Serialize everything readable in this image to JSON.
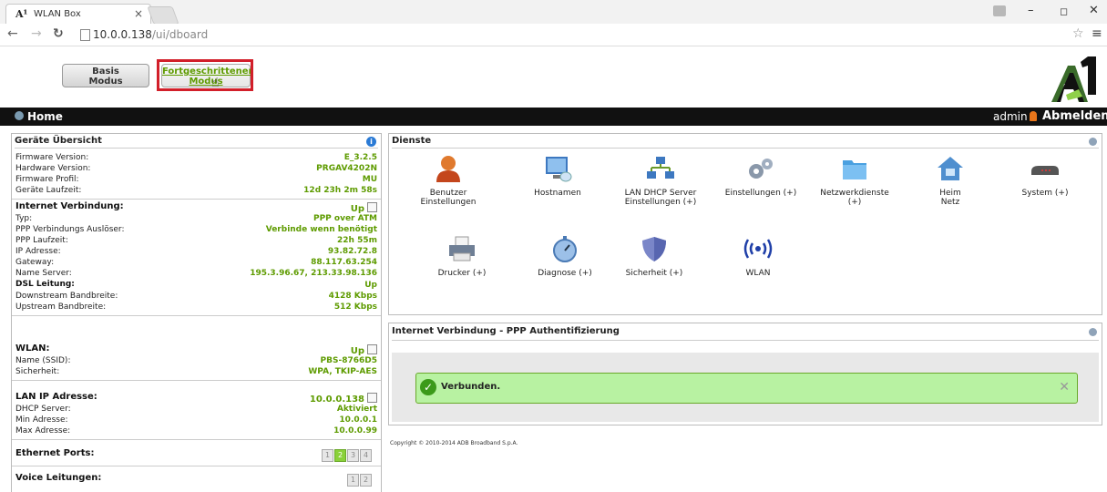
{
  "browser": {
    "tab_logo": "A¹",
    "tab_title": "WLAN Box",
    "tab_close": "×",
    "url_host": "10.0.0.138",
    "url_path": "/ui/dboard",
    "min_glyph": "–",
    "max_glyph": "◻",
    "close_glyph": "✕"
  },
  "modes": {
    "basis_line1": "Basis",
    "basis_line2": "Modus",
    "fort_line1": "Fortgeschrittener",
    "fort_line2": "Modus"
  },
  "header": {
    "home": "Home",
    "user": "admin",
    "logout": "Abmelden"
  },
  "overview": {
    "title": "Geräte Übersicht",
    "firmware_label": "Firmware Version:",
    "firmware_value": "E_3.2.5",
    "hardware_label": "Hardware Version:",
    "hardware_value": "PRGAV4202N",
    "profile_label": "Firmware Profil:",
    "profile_value": "MU",
    "uptime_label": "Geräte Laufzeit:",
    "uptime_value": "12d 23h 2m 58s",
    "inet_heading": "Internet Verbindung:",
    "inet_status": "Up",
    "type_label": "Typ:",
    "type_value": "PPP over ATM",
    "trigger_label": "PPP Verbindungs Auslöser:",
    "trigger_value": "Verbinde wenn benötigt",
    "ppp_uptime_label": "PPP Laufzeit:",
    "ppp_uptime_value": "22h 55m",
    "ip_label": "IP Adresse:",
    "ip_value": "93.82.72.8",
    "gw_label": "Gateway:",
    "gw_value": "88.117.63.254",
    "dns_label": "Name Server:",
    "dns_value": "195.3.96.67, 213.33.98.136",
    "dsl_heading": "DSL Leitung:",
    "dsl_status": "Up",
    "down_label": "Downstream Bandbreite:",
    "down_value": "4128 Kbps",
    "up_label": "Upstream Bandbreite:",
    "up_value": "512 Kbps",
    "wlan_heading": "WLAN:",
    "wlan_status": "Up",
    "ssid_label": "Name (SSID):",
    "ssid_value": "PBS-8766D5",
    "sec_label": "Sicherheit:",
    "sec_value": "WPA, TKIP-AES",
    "lan_heading": "LAN IP Adresse:",
    "lan_value": "10.0.0.138",
    "dhcp_label": "DHCP Server:",
    "dhcp_value": "Aktiviert",
    "min_label": "Min Adresse:",
    "min_value": "10.0.0.1",
    "max_label": "Max Adresse:",
    "max_value": "10.0.0.99",
    "eth_heading": "Ethernet Ports:",
    "voice_heading": "Voice Leitungen:",
    "eth_ports": [
      "1",
      "2",
      "3",
      "4"
    ],
    "voice_ports": [
      "1",
      "2"
    ]
  },
  "services": {
    "title": "Dienste",
    "items": [
      {
        "l1": "Benutzer",
        "l2": "Einstellungen",
        "icon": "user-icon"
      },
      {
        "l1": "Hostnamen",
        "l2": "",
        "icon": "monitor-icon"
      },
      {
        "l1": "LAN DHCP Server",
        "l2": "Einstellungen (+)",
        "icon": "network-icon"
      },
      {
        "l1": "Einstellungen (+)",
        "l2": "",
        "icon": "gears-icon"
      },
      {
        "l1": "Netzwerkdienste",
        "l2": "(+)",
        "icon": "folder-icon"
      },
      {
        "l1": "Heim",
        "l2": "Netz",
        "icon": "home-network-icon"
      },
      {
        "l1": "System (+)",
        "l2": "",
        "icon": "router-icon"
      },
      {
        "l1": "Drucker (+)",
        "l2": "",
        "icon": "printer-icon"
      },
      {
        "l1": "Diagnose (+)",
        "l2": "",
        "icon": "stopwatch-icon"
      },
      {
        "l1": "Sicherheit (+)",
        "l2": "",
        "icon": "shield-icon"
      },
      {
        "l1": "WLAN",
        "l2": "",
        "icon": "wifi-icon"
      }
    ]
  },
  "ppp": {
    "title": "Internet Verbindung - PPP Authentifizierung",
    "status": "Verbunden.",
    "close": "✕"
  },
  "footer": {
    "copyright": "Copyright © 2010-2014 ADB Broadband S.p.A."
  }
}
